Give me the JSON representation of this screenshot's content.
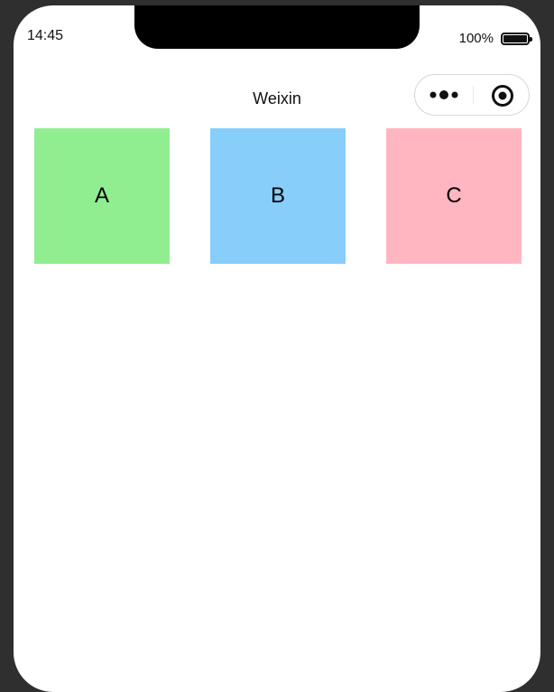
{
  "status_bar": {
    "time": "14:45",
    "battery_percent": "100%",
    "battery_level": 1.0
  },
  "nav_bar": {
    "title": "Weixin",
    "capsule": {
      "more_icon": "more-dots-icon",
      "close_icon": "target-close-icon"
    }
  },
  "blocks": [
    {
      "label": "A",
      "color": "#90EE90"
    },
    {
      "label": "B",
      "color": "#87CEFA"
    },
    {
      "label": "C",
      "color": "#FFB6C1"
    }
  ]
}
